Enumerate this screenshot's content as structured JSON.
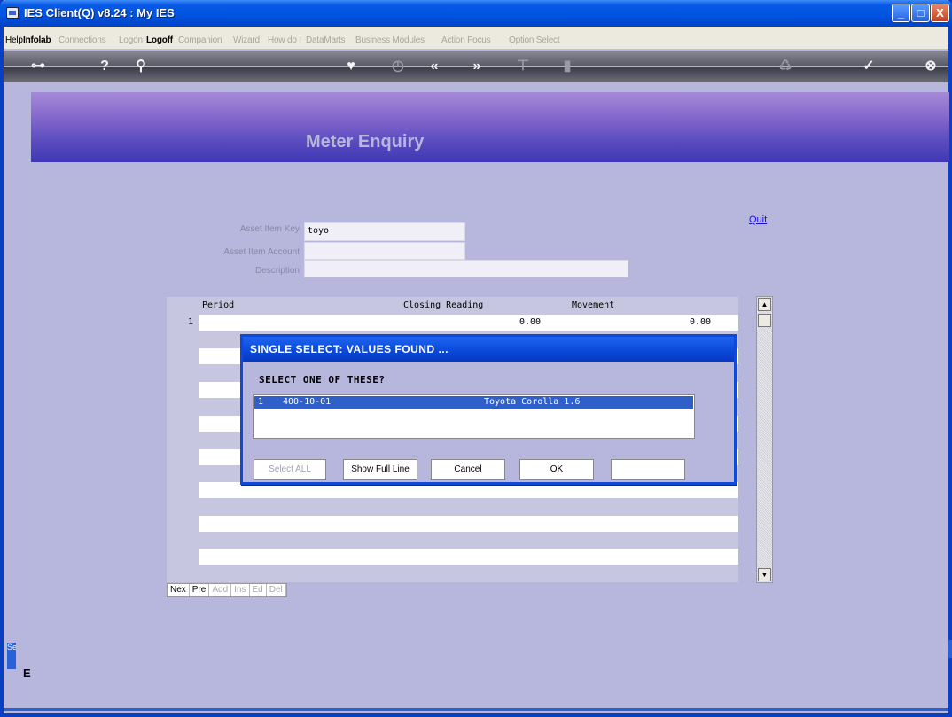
{
  "window": {
    "title": "IES Client(Q) v8.24 : My IES",
    "controls": {
      "minimize": "_",
      "maximize": "□",
      "close": "X"
    }
  },
  "menu": {
    "items": [
      {
        "label": "Help",
        "enabled": true,
        "bold": false
      },
      {
        "label": "Infolab",
        "enabled": true,
        "bold": true
      },
      {
        "label": "Connections",
        "enabled": false,
        "bold": false
      },
      {
        "label": "Logon",
        "enabled": false,
        "bold": false
      },
      {
        "label": "Logoff",
        "enabled": true,
        "bold": true
      },
      {
        "label": "Companion",
        "enabled": false,
        "bold": false
      },
      {
        "label": "Wizard",
        "enabled": false,
        "bold": false
      },
      {
        "label": "How do I",
        "enabled": false,
        "bold": false
      },
      {
        "label": "DataMarts",
        "enabled": false,
        "bold": false
      },
      {
        "label": "Business Modules",
        "enabled": false,
        "bold": false
      },
      {
        "label": "Action Focus",
        "enabled": false,
        "bold": false
      },
      {
        "label": "Option Select",
        "enabled": false,
        "bold": false
      }
    ]
  },
  "toolbar": {
    "icons": [
      "key-icon",
      "help-icon",
      "search-icon",
      "heart-icon",
      "clock-icon",
      "rewind-icon",
      "forward-icon",
      "tree-icon",
      "window-icon",
      "recycle-icon",
      "check-icon",
      "close-icon"
    ]
  },
  "banner": {
    "title": "Meter Enquiry"
  },
  "form": {
    "quit_label": "Quit",
    "asset_item_key_label": "Asset Item Key",
    "asset_item_key_value": "toyo",
    "asset_item_account_label": "Asset Item Account",
    "asset_item_account_value": "",
    "description_label": "Description",
    "description_value": ""
  },
  "grid": {
    "headers": {
      "period": "Period",
      "closing_reading": "Closing Reading",
      "movement": "Movement"
    },
    "rows": [
      {
        "num": "1",
        "period": "",
        "closing_reading": "0.00",
        "movement": "0.00"
      }
    ]
  },
  "nav_buttons": [
    {
      "label": "Nex",
      "enabled": true
    },
    {
      "label": "Pre",
      "enabled": true
    },
    {
      "label": "Add",
      "enabled": false
    },
    {
      "label": "Ins",
      "enabled": false
    },
    {
      "label": "Ed",
      "enabled": false
    },
    {
      "label": "Del",
      "enabled": false
    }
  ],
  "dialog": {
    "title": "SINGLE SELECT: VALUES FOUND ...",
    "prompt": "SELECT ONE OF THESE?",
    "options": [
      {
        "num": "1",
        "code": "400-10-01",
        "name": "Toyota Corolla 1.6",
        "selected": true
      }
    ],
    "buttons": {
      "select_all": "Select ALL",
      "show_full_line": "Show Full Line",
      "cancel": "Cancel",
      "ok": "OK"
    },
    "side_input_value": ""
  },
  "session": {
    "tab_label": "Ses",
    "letter": "E"
  },
  "colors": {
    "background": "#b7b6dc",
    "titlebar": "#0053e0",
    "banner_start": "#a68ad8",
    "banner_end": "#3f38b4",
    "selected_row": "#2f5fc9",
    "link": "#1a0fd6"
  }
}
